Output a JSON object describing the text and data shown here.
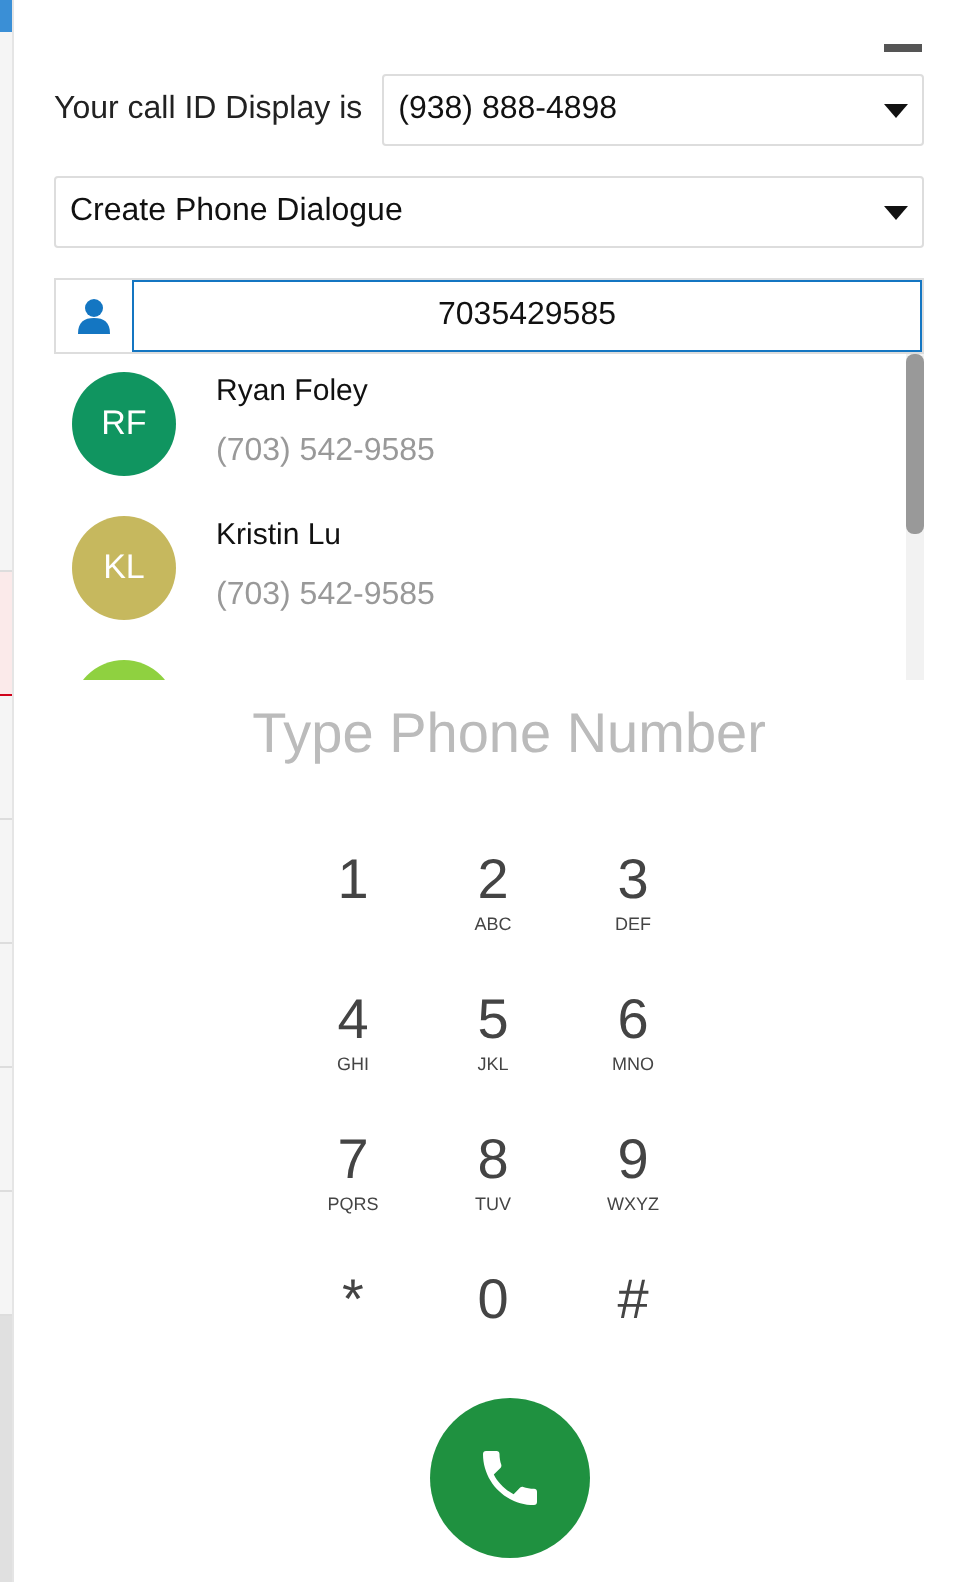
{
  "caller_id": {
    "label": "Your call ID Display is",
    "value": "(938) 888-4898"
  },
  "action_select": {
    "value": "Create Phone Dialogue"
  },
  "search": {
    "value": "7035429585"
  },
  "contacts": [
    {
      "initials": "RF",
      "name": "Ryan Foley",
      "phone": "(703) 542-9585",
      "color": "#109560"
    },
    {
      "initials": "KL",
      "name": "Kristin Lu",
      "phone": "(703) 542-9585",
      "color": "#c6b85e"
    },
    {
      "color": "#8fd140"
    }
  ],
  "dialer": {
    "placeholder": "Type Phone Number",
    "keys": [
      {
        "digit": "1"
      },
      {
        "digit": "2",
        "letters": "ABC"
      },
      {
        "digit": "3",
        "letters": "DEF"
      },
      {
        "digit": "4",
        "letters": "GHI"
      },
      {
        "digit": "5",
        "letters": "JKL"
      },
      {
        "digit": "6",
        "letters": "MNO"
      },
      {
        "digit": "7",
        "letters": "PQRS"
      },
      {
        "digit": "8",
        "letters": "TUV"
      },
      {
        "digit": "9",
        "letters": "WXYZ"
      },
      {
        "digit": "*"
      },
      {
        "digit": "0"
      },
      {
        "digit": "#"
      }
    ]
  }
}
